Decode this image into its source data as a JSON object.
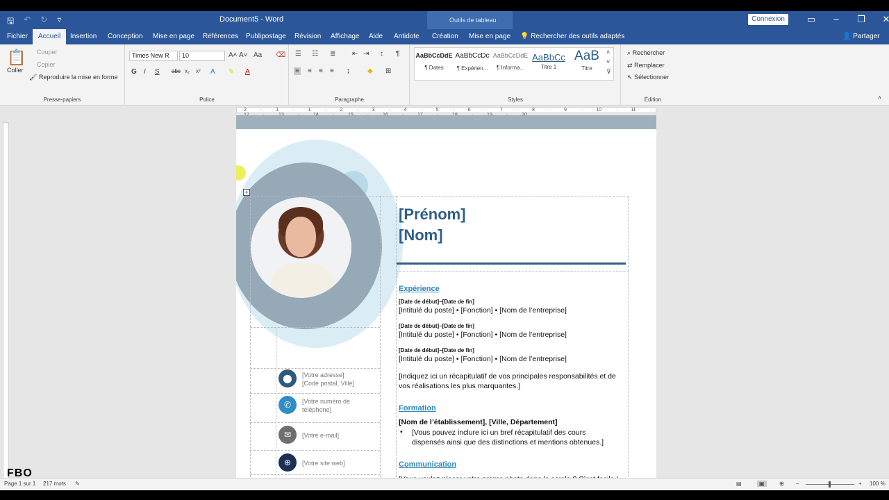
{
  "window": {
    "doc_title": "Document5  -  Word",
    "context_label": "Outils de tableau",
    "sign_in": "Connexion"
  },
  "tabs": [
    "Fichier",
    "Accueil",
    "Insertion",
    "Conception",
    "Mise en page",
    "Références",
    "Publipostage",
    "Révision",
    "Affichage",
    "Aide",
    "Antidote",
    "Création",
    "Mise en page"
  ],
  "tell_me": "Rechercher des outils adaptés",
  "share": "Partager",
  "ribbon": {
    "clipboard": {
      "paste": "Coller",
      "cut": "Couper",
      "copy": "Copier",
      "format_painter": "Reproduire la mise en forme",
      "label": "Presse-papiers"
    },
    "font": {
      "family": "Times New R",
      "size": "10",
      "label": "Police"
    },
    "paragraph": {
      "label": "Paragraphe"
    },
    "styles": {
      "label": "Styles",
      "items": [
        {
          "preview": "AaBbCcDdE",
          "name": "¶ Dates"
        },
        {
          "preview": "AaBbCcDc",
          "name": "¶ Expérien..."
        },
        {
          "preview": "AaBbCcDdE",
          "name": "¶ Informa..."
        },
        {
          "preview": "AaBbCc",
          "name": "Titre 1"
        },
        {
          "preview": "AaB",
          "name": "Titre"
        }
      ]
    },
    "editing": {
      "find": "Rechercher",
      "replace": "Remplacer",
      "select": "Sélectionner",
      "label": "Édition"
    }
  },
  "ruler_numbers": [
    "2",
    "1",
    "1",
    "2",
    "3",
    "4",
    "5",
    "6",
    "7",
    "8",
    "9",
    "10",
    "11",
    "12",
    "13",
    "14",
    "15",
    "16",
    "17",
    "18",
    "19",
    "20"
  ],
  "document": {
    "first_name": "[Prénom]",
    "last_name": "[Nom]",
    "contact": {
      "address": "[Votre adresse]",
      "postal": "[Code postal, Ville]",
      "phone1": "[Votre numéro de",
      "phone2": "téléphone]",
      "email": "[Votre e-mail]",
      "website": "[Votre site web]"
    },
    "experience_title": "Expérience",
    "jobs": [
      {
        "dates": "[Date de début]–[Date de fin]",
        "line": "[Intitulé du poste] • [Fonction] • [Nom de l’entreprise]"
      },
      {
        "dates": "[Date de début]–[Date de fin]",
        "line": "[Intitulé du poste] • [Fonction] • [Nom de l’entreprise]"
      },
      {
        "dates": "[Date de début]–[Date de fin]",
        "line": "[Intitulé du poste] • [Fonction] • [Nom de l’entreprise]"
      }
    ],
    "experience_summary": "[Indiquez ici un récapitulatif de vos principales responsabilités et de vos réalisations les plus marquantes.]",
    "education_title": "Formation",
    "school": "[Nom de l’établissement], [Ville, Département]",
    "school_bullet": "[Vous pouvez inclure ici un bref récapitulatif des cours dispensés ainsi que des distinctions et mentions obtenues.]",
    "communication_title": "Communication",
    "communication_text": "[Vous voulez placer votre propre photo dans le cercle ? C’est facile !"
  },
  "status": {
    "page": "Page 1 sur 1",
    "words": "217 mots",
    "zoom": "100 %"
  },
  "watermark": "FBO",
  "colors": {
    "brand": "#2b579a",
    "name_blue": "#2d5f86",
    "section_blue": "#2e89c0",
    "ring": "#95a9b6"
  }
}
